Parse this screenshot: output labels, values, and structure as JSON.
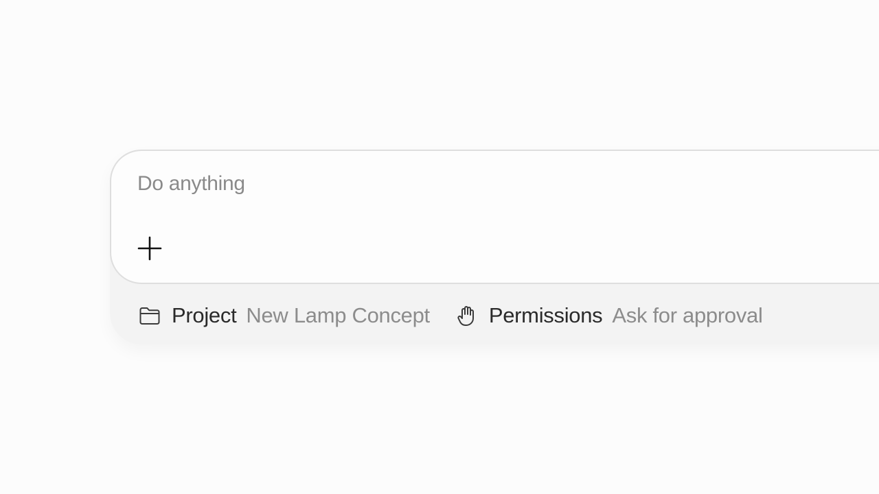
{
  "composer": {
    "input": {
      "placeholder": "Do anything",
      "value": ""
    },
    "add_button": {
      "icon": "plus-icon"
    },
    "footer": {
      "project": {
        "icon": "folder-icon",
        "label": "Project",
        "value": "New Lamp Concept"
      },
      "permissions": {
        "icon": "hand-icon",
        "label": "Permissions",
        "value": "Ask for approval"
      }
    }
  },
  "colors": {
    "background": "#fcfcfc",
    "card": "#fdfdfd",
    "footer": "#f3f3f3",
    "border": "#dedede",
    "label_text": "#2a2a2a",
    "muted_text": "#8c8c8c"
  }
}
